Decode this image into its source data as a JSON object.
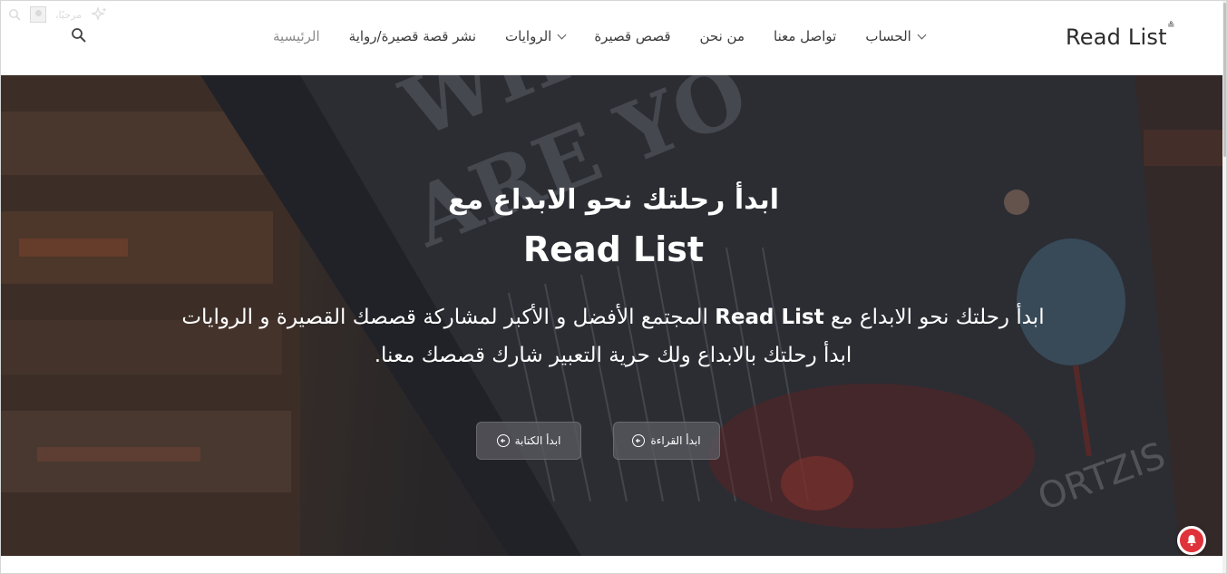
{
  "adminbar": {
    "greeting": "مرحبًا،",
    "icons": [
      "search-icon",
      "avatar",
      "sparkle-icon"
    ]
  },
  "brand": {
    "name": "Read List",
    "mark": "•̶"
  },
  "nav": {
    "items": [
      {
        "label": "الرئيسية",
        "active": true,
        "dropdown": false
      },
      {
        "label": "نشر قصة قصيرة/رواية",
        "active": false,
        "dropdown": false
      },
      {
        "label": "الروايات",
        "active": false,
        "dropdown": true
      },
      {
        "label": "قصص قصيرة",
        "active": false,
        "dropdown": false
      },
      {
        "label": "من نحن",
        "active": false,
        "dropdown": false
      },
      {
        "label": "تواصل معنا",
        "active": false,
        "dropdown": false
      },
      {
        "label": "الحساب",
        "active": false,
        "dropdown": true
      }
    ],
    "search_icon": "search-icon"
  },
  "hero": {
    "subtitle": "ابدأ رحلتك نحو الابداع مع",
    "title": "Read List",
    "desc_line1_pre": "ابدأ رحلتك نحو الابداع مع",
    "desc_line1_brand": "Read List",
    "desc_line1_post": "المجتمع الأفضل و الأكبر لمشاركة قصصك القصيرة و الروايات",
    "desc_line2": "ابدأ رحلتك بالابداع ولك حرية التعبير شارك قصصك معنا.",
    "read_button": "ابدأ القراءة",
    "write_button": "ابدأ الكتابة"
  },
  "colors": {
    "accent_bell": "#e0323a",
    "nav_text": "#3b3b3b",
    "nav_active": "#8a8a8a"
  }
}
